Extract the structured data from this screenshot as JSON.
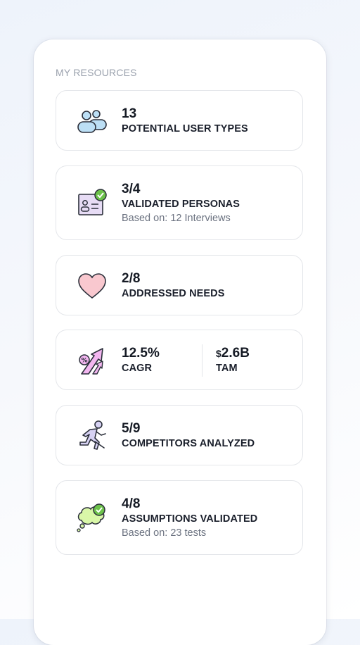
{
  "section_title": "MY RESOURCES",
  "cards": [
    {
      "value": "13",
      "label": "POTENTIAL USER TYPES",
      "icon": "users-icon"
    },
    {
      "value": "3/4",
      "label": "VALIDATED PERSONAS",
      "sub": "Based on: 12 Interviews",
      "icon": "id-card-check-icon"
    },
    {
      "value": "2/8",
      "label": "ADDRESSED NEEDS",
      "icon": "heart-icon"
    },
    {
      "value": "12.5%",
      "label": "CAGR",
      "icon": "growth-arrow-icon",
      "value2_currency": "$",
      "value2": "2.6B",
      "label2": "TAM"
    },
    {
      "value": "5/9",
      "label": "COMPETITORS ANALYZED",
      "icon": "runner-icon"
    },
    {
      "value": "4/8",
      "label": "ASSUMPTIONS VALIDATED",
      "sub": "Based on: 23 tests",
      "icon": "thought-bubble-check-icon"
    }
  ],
  "colors": {
    "users": "#bcdff5",
    "persona": "#e7dcf5",
    "check": "#6cc24a",
    "heart": "#f9c8cf",
    "growth": "#f3b6f0",
    "runner": "#d7d2f3",
    "bubble": "#d9f7a8"
  }
}
